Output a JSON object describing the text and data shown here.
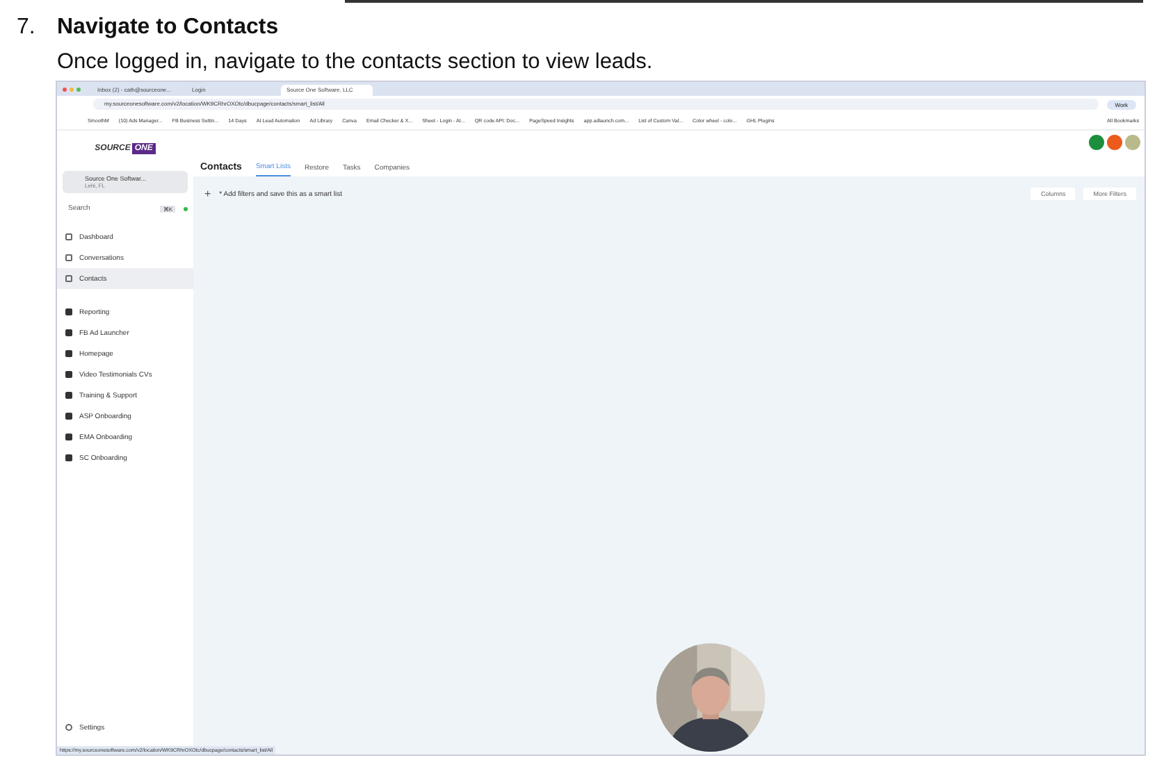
{
  "step": {
    "number": "7.",
    "title": "Navigate to Contacts",
    "text": "Once logged in, navigate to the contacts section to view leads."
  },
  "browser": {
    "tabs": [
      {
        "label": "Inbox (2) - cath@sourceone...",
        "selected": false
      },
      {
        "label": "Login",
        "selected": false
      },
      {
        "label": "Source One Software, LLC",
        "selected": true
      }
    ],
    "url": "my.sourceonesoftware.com/v2/location/WK9CRhrOXOtc/dbucpage/contacts/smart_list/All",
    "profile": "Work",
    "bookmarks": [
      "SmoothM",
      "(10) Ads Manager...",
      "FB Business Settin...",
      "14 Days",
      "AI Lead Automation",
      "Ad Library",
      "Canva",
      "Email Checker & X...",
      "Sheet - Login - AI...",
      "QR code API: Doc...",
      "PageSpeed Insights",
      "app.adlaunch.com...",
      "List of Custom Val...",
      "Color wheel - colo...",
      "GHL Plugins"
    ],
    "all_bookmarks": "All Bookmarks",
    "status_url": "https://my.sourceonesoftware.com/v2/location/WK9CRhrOXOtc/dbucpage/contacts/smart_list/All"
  },
  "app": {
    "logo": {
      "top": "SOURCE",
      "badge": "ONE"
    },
    "account": {
      "name": "Source One Softwar...",
      "location": "Lehi, FL"
    },
    "search": {
      "placeholder": "Search",
      "shortcut": "⌘K"
    },
    "nav_main": [
      {
        "label": "Dashboard",
        "selected": false
      },
      {
        "label": "Conversations",
        "selected": false
      },
      {
        "label": "Contacts",
        "selected": true
      }
    ],
    "nav_apps": [
      {
        "label": "Reporting"
      },
      {
        "label": "FB Ad Launcher"
      },
      {
        "label": "Homepage"
      },
      {
        "label": "Video Testimonials CVs"
      },
      {
        "label": "Training & Support"
      },
      {
        "label": "ASP Onboarding"
      },
      {
        "label": "EMA Onboarding"
      },
      {
        "label": "SC Onboarding"
      }
    ],
    "settings": "Settings",
    "header_title": "Contacts",
    "header_tabs": [
      {
        "label": "Smart Lists",
        "selected": true
      },
      {
        "label": "Restore",
        "selected": false
      },
      {
        "label": "Tasks",
        "selected": false
      },
      {
        "label": "Companies",
        "selected": false
      }
    ],
    "plus": "+",
    "add_filter": "* Add filters and save this as a smart list",
    "columns": "Columns",
    "more_filters": "More Filters"
  }
}
